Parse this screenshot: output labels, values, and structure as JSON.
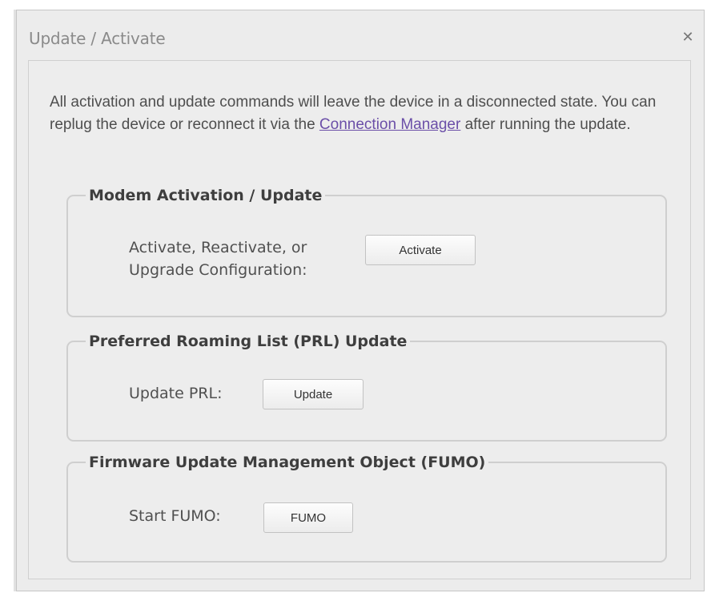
{
  "dialog": {
    "title": "Update / Activate",
    "close_glyph": "✕"
  },
  "intro": {
    "text_before_link": "All activation and update commands will leave the device in a disconnected state. You can replug the device or reconnect it via the ",
    "link_text": "Connection Manager",
    "text_after_link": " after running the update."
  },
  "modem": {
    "legend": "Modem Activation / Update",
    "label_line1": "Activate, Reactivate, or",
    "label_line2": "Upgrade Configuration:",
    "button_label": "Activate"
  },
  "prl": {
    "legend": "Preferred Roaming List (PRL) Update",
    "label": "Update PRL:",
    "button_label": "Update"
  },
  "fumo": {
    "legend": "Firmware Update Management Object (FUMO)",
    "label": "Start FUMO:",
    "button_label": "FUMO"
  },
  "icons": {
    "close": "close-icon"
  },
  "colors": {
    "link": "#6b4fa8",
    "dialog_bg": "#ececec"
  }
}
